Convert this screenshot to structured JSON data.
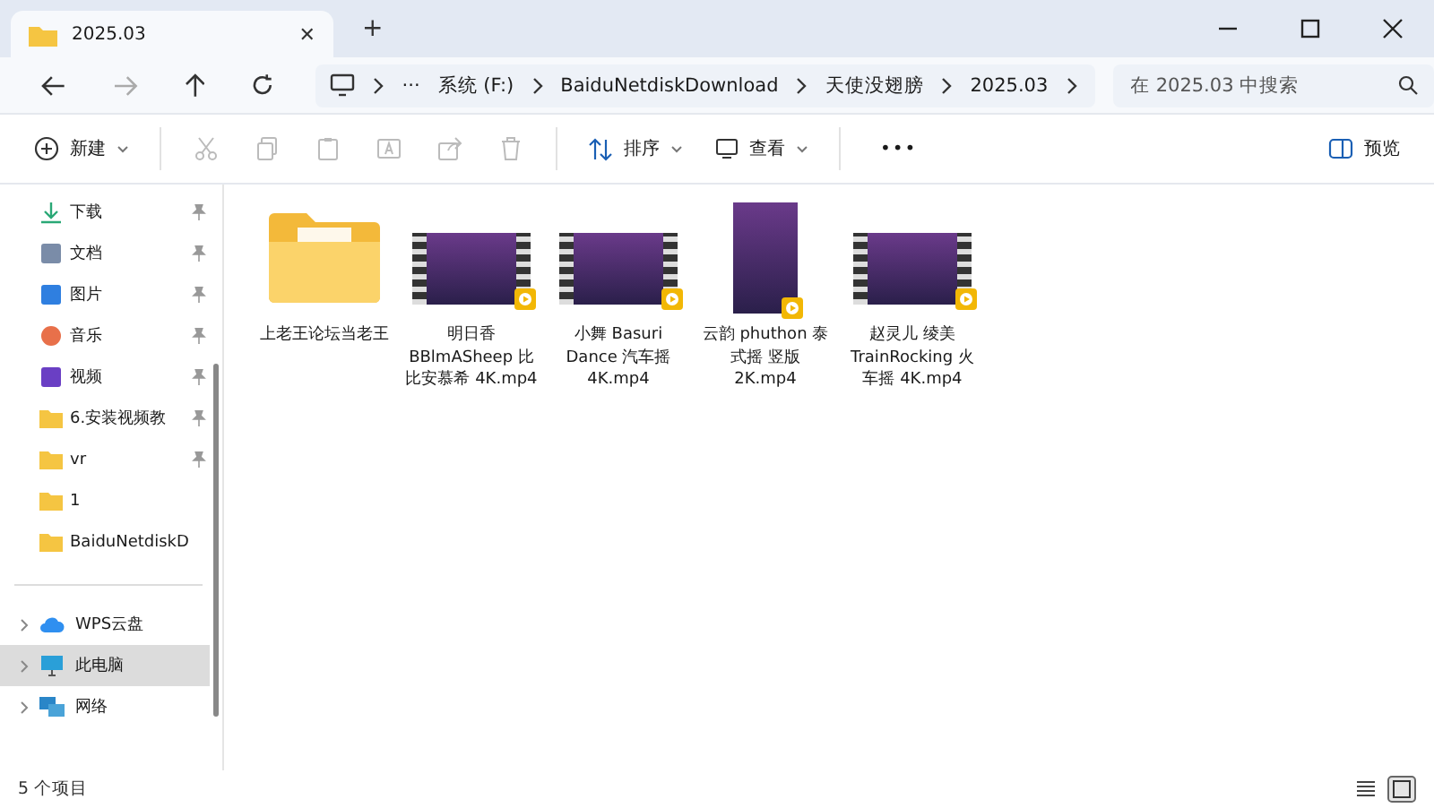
{
  "window": {
    "tab_title": "2025.03",
    "tab_close": "✕",
    "new_tab": "+"
  },
  "address": {
    "more": "···",
    "segments": [
      "系统 (F:)",
      "BaiduNetdiskDownload",
      "天使没翅膀",
      "2025.03"
    ]
  },
  "search": {
    "placeholder": "在 2025.03 中搜索"
  },
  "commands": {
    "new_label": "新建",
    "sort_label": "排序",
    "view_label": "查看",
    "more": "•••",
    "preview_label": "预览"
  },
  "sidebar": {
    "quick": [
      {
        "label": "下载",
        "kind": "download",
        "pinned": true
      },
      {
        "label": "文档",
        "kind": "document",
        "pinned": true
      },
      {
        "label": "图片",
        "kind": "picture",
        "pinned": true
      },
      {
        "label": "音乐",
        "kind": "music",
        "pinned": true
      },
      {
        "label": "视频",
        "kind": "video",
        "pinned": true
      },
      {
        "label": "6.安装视频教",
        "kind": "folder",
        "pinned": true
      },
      {
        "label": "vr",
        "kind": "folder",
        "pinned": true
      },
      {
        "label": "1",
        "kind": "folder",
        "pinned": false
      },
      {
        "label": "BaiduNetdiskD",
        "kind": "folder",
        "pinned": false
      }
    ],
    "locations": [
      {
        "label": "WPS云盘",
        "kind": "cloud",
        "selected": false
      },
      {
        "label": "此电脑",
        "kind": "pc",
        "selected": true
      },
      {
        "label": "网络",
        "kind": "network",
        "selected": false
      }
    ]
  },
  "files": [
    {
      "name": "上老王论坛当老王",
      "kind": "folder"
    },
    {
      "name": "明日香 BBlmASheep 比比安慕希 4K.mp4",
      "kind": "video",
      "portrait": false
    },
    {
      "name": "小舞 Basuri Dance 汽车摇 4K.mp4",
      "kind": "video",
      "portrait": false
    },
    {
      "name": "云韵 phuthon 泰式摇 竖版 2K.mp4",
      "kind": "video",
      "portrait": true
    },
    {
      "name": "赵灵儿 绫美 TrainRocking 火车摇 4K.mp4",
      "kind": "video",
      "portrait": false
    }
  ],
  "status_bar": {
    "count": "5 个项目"
  }
}
